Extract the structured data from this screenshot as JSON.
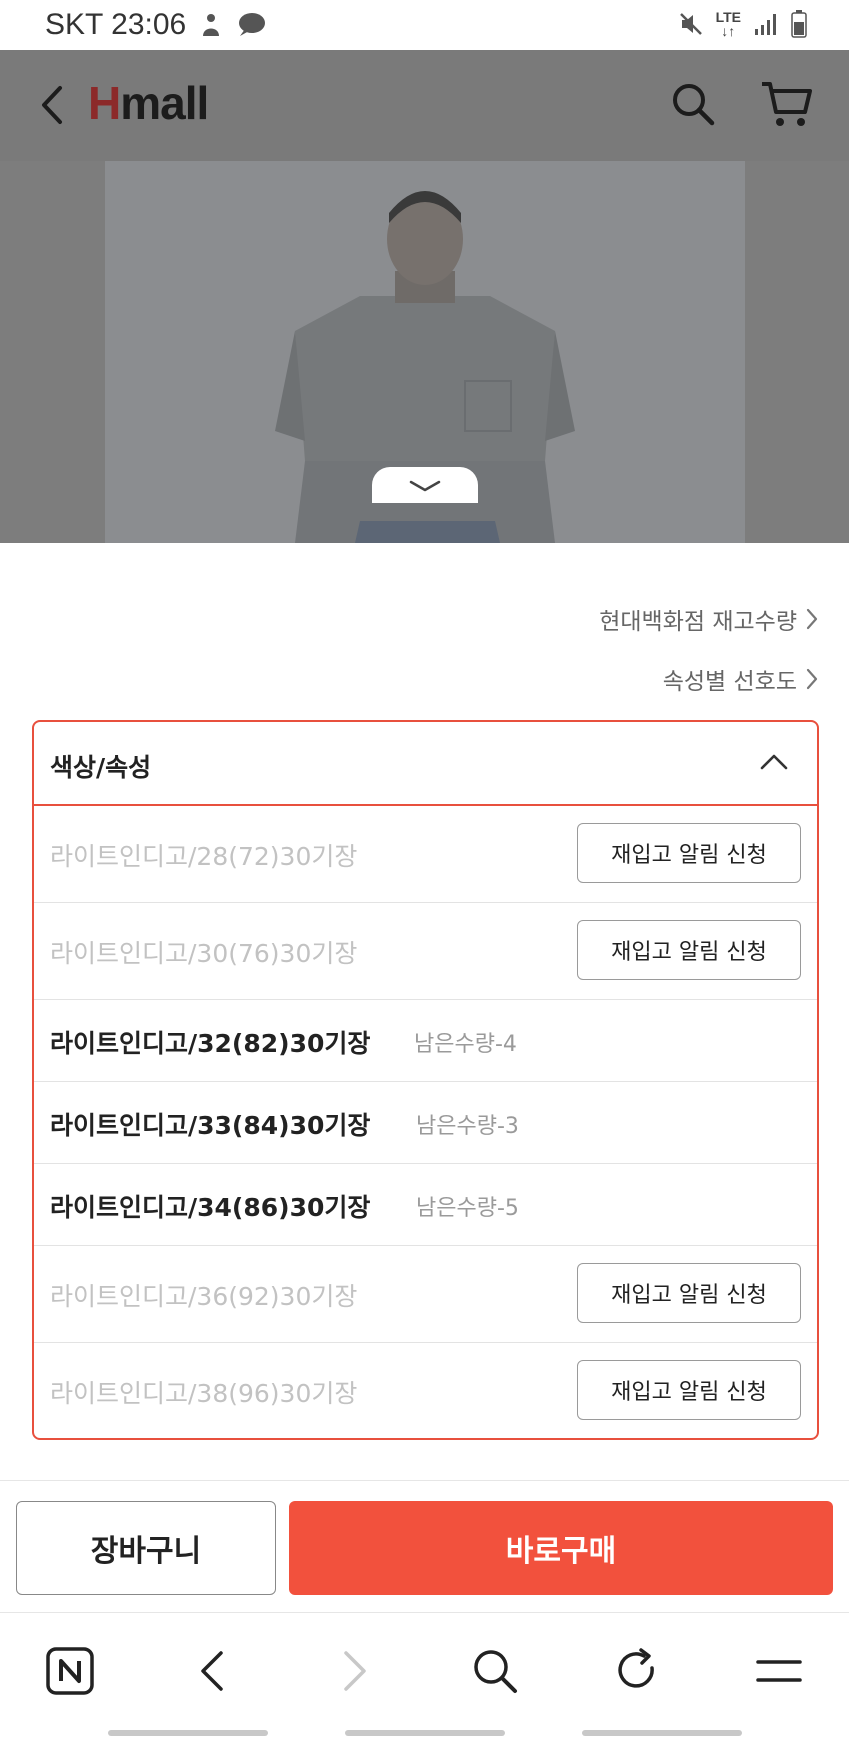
{
  "status_bar": {
    "carrier_time": "SKT 23:06",
    "network": "LTE"
  },
  "header": {
    "logo_h": "H",
    "logo_rest": "mall"
  },
  "info_links": {
    "stock": "현대백화점 재고수량",
    "preference": "속성별 선호도"
  },
  "options": {
    "title": "색상/속성",
    "restock_label": "재입고 알림 신청",
    "items": [
      {
        "name": "라이트인디고/28(72)30기장",
        "stock": ""
      },
      {
        "name": "라이트인디고/30(76)30기장",
        "stock": ""
      },
      {
        "name": "라이트인디고/32(82)30기장",
        "stock": "남은수량-4"
      },
      {
        "name": "라이트인디고/33(84)30기장",
        "stock": "남은수량-3"
      },
      {
        "name": "라이트인디고/34(86)30기장",
        "stock": "남은수량-5"
      },
      {
        "name": "라이트인디고/36(92)30기장",
        "stock": ""
      },
      {
        "name": "라이트인디고/38(96)30기장",
        "stock": ""
      }
    ]
  },
  "actions": {
    "cart": "장바구니",
    "buy_now": "바로구매"
  },
  "colors": {
    "accent": "#f2513d",
    "panel_border": "#e8503e"
  },
  "icons": [
    "back-icon",
    "search-icon",
    "cart-icon",
    "chevron-down-icon",
    "chevron-right-icon",
    "chevron-up-icon",
    "naver-icon",
    "forward-icon",
    "refresh-icon",
    "menu-icon"
  ]
}
